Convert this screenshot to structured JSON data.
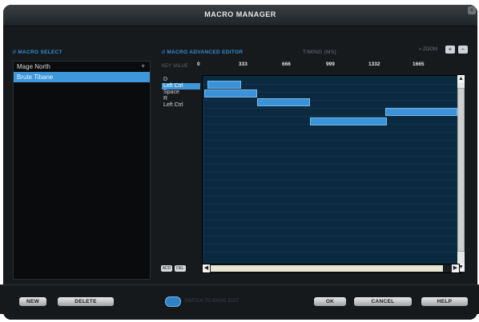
{
  "window": {
    "title": "MACRO MANAGER"
  },
  "left": {
    "section_title": "// MACRO SELECT",
    "list": [
      {
        "label": "Mage North",
        "selected": false,
        "arrow": "▼"
      },
      {
        "label": "Brute Tibane",
        "selected": true
      }
    ],
    "new_label": "NEW",
    "delete_label": "DELETE"
  },
  "editor": {
    "section_title": "// MACRO ADVANCED EDITOR",
    "subtitle": "TIMING (MS)",
    "zoom_label": "ZOOM",
    "key_value_label": "KEY VALUE",
    "ticks": [
      "0",
      "333",
      "666",
      "999",
      "1332",
      "1665"
    ],
    "keys": [
      {
        "label": "D",
        "selected": false
      },
      {
        "label": "Left Ctrl",
        "selected": true
      },
      {
        "label": "Space",
        "selected": false
      },
      {
        "label": "R",
        "selected": false
      },
      {
        "label": "Left Ctrl",
        "selected": false
      }
    ],
    "mini_buttons": [
      "ADD",
      "DEL"
    ]
  },
  "footer": {
    "switch_label": "SWITCH TO BASIC EDIT",
    "ok_label": "OK",
    "cancel_label": "CANCEL",
    "help_label": "HELP"
  },
  "colors": {
    "accent": "#3b92d8",
    "background": "#171a1d",
    "editor_bg": "#0c2a3f"
  }
}
